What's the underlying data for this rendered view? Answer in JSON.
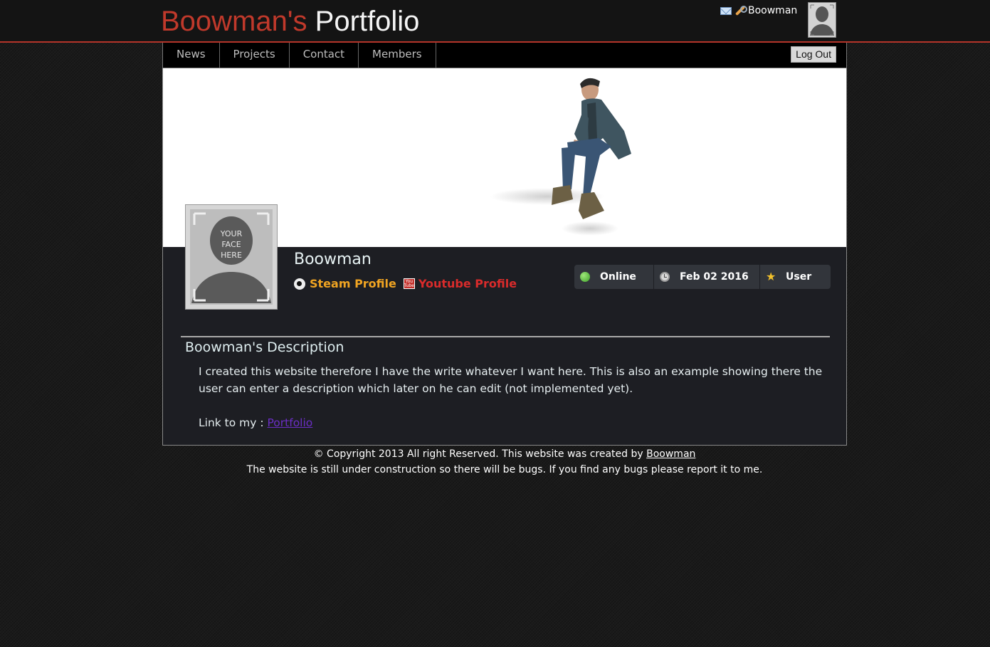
{
  "header": {
    "title_owner": "Boowman's",
    "title_rest": "Portfolio",
    "username": "Boowman",
    "mail_icon": "envelope-icon",
    "tools_icon": "wrench-icon"
  },
  "nav": {
    "items": [
      {
        "label": "News"
      },
      {
        "label": "Projects"
      },
      {
        "label": "Contact"
      },
      {
        "label": "Members"
      }
    ],
    "logout_label": "Log Out"
  },
  "profile": {
    "name": "Boowman",
    "avatar_placeholder": [
      "YOUR",
      "FACE",
      "HERE"
    ],
    "steam_label": "Steam Profile",
    "youtube_label": "Youtube Profile",
    "youtube_icon_text": [
      "You",
      "Tube"
    ],
    "status": "Online",
    "date": "Feb 02 2016",
    "role": "User"
  },
  "description": {
    "heading": "Boowman's Description",
    "body": "I created this website therefore I have the write whatever I want here. This is also an example showing there the user can enter a description which later on he can edit (not implemented yet).",
    "link_prefix": "Link to my :",
    "link_label": "Portfolio"
  },
  "footer": {
    "copyright_prefix": "© Copyright 2013 All right Reserved. This website was created by",
    "author_link": "Boowman",
    "notice": "The website is still under construction so there will be bugs. If you find any bugs please report it to me."
  },
  "colors": {
    "accent_red": "#c0392b",
    "steam_orange": "#f0a422",
    "youtube_red": "#d92b2b",
    "link_purple": "#6b2ec5",
    "panel_bg": "#1d1e23"
  }
}
